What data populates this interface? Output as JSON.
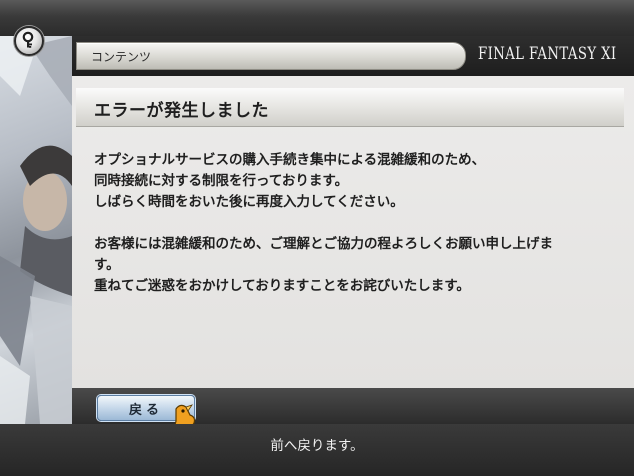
{
  "header": {
    "section_label": "コンテンツ",
    "logo_text": "FINAL FANTASY XI"
  },
  "dialog": {
    "title": "エラーが発生しました",
    "message_lines": [
      "オプショナルサービスの購入手続き集中による混雑緩和のため、",
      "同時接続に対する制限を行っております。",
      "しばらく時間をおいた後に再度入力してください。",
      "",
      "お客様には混雑緩和のため、ご理解とご協力の程よろしくお願い申し上げま",
      "す。",
      "重ねてご迷惑をおかけしておりますことをお詫びいたします。"
    ]
  },
  "footer": {
    "back_label": "戻る",
    "status_text": "前へ戻ります。"
  },
  "icons": {
    "help": "key-help-icon",
    "cursor": "chocobo-hand-cursor-icon"
  },
  "colors": {
    "background": "#242424",
    "panel": "#e8e7e5",
    "button": "#c6d8ea",
    "text_light": "#f2f2f2"
  }
}
